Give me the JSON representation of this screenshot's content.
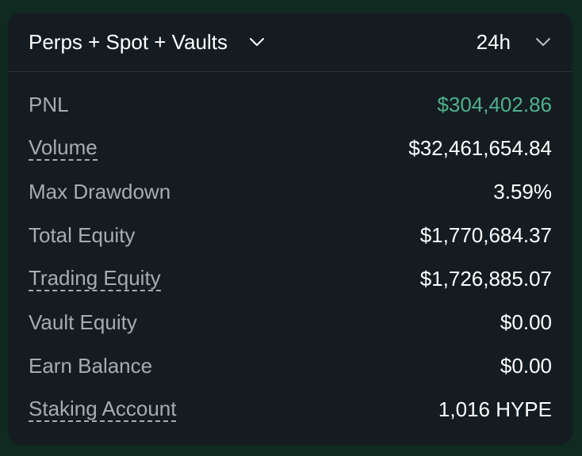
{
  "header": {
    "scope_selector": "Perps + Spot + Vaults",
    "period_selector": "24h"
  },
  "colors": {
    "positive": "#4fb08a",
    "card_bg": "#141c22",
    "label": "#a6adb1",
    "value": "#ffffff"
  },
  "rows": [
    {
      "label": "PNL",
      "value": "$304,402.86"
    },
    {
      "label": "Volume",
      "value": "$32,461,654.84"
    },
    {
      "label": "Max Drawdown",
      "value": "3.59%"
    },
    {
      "label": "Total Equity",
      "value": "$1,770,684.37"
    },
    {
      "label": "Trading Equity",
      "value": "$1,726,885.07"
    },
    {
      "label": "Vault Equity",
      "value": "$0.00"
    },
    {
      "label": "Earn Balance",
      "value": "$0.00"
    },
    {
      "label": "Staking Account",
      "value": "1,016 HYPE"
    }
  ]
}
